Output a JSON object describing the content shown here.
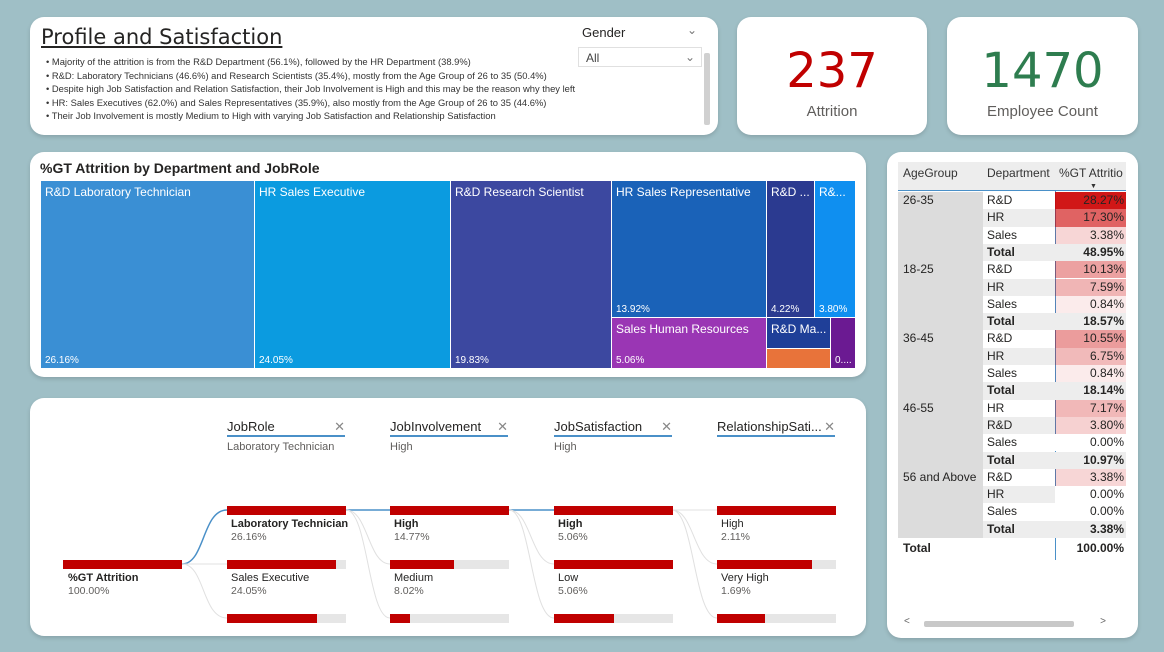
{
  "profile": {
    "title": "Profile and Satisfaction",
    "bullets": [
      "Majority of the attrition is from the R&D Department (56.1%), followed by the HR Department (38.9%)",
      "R&D: Laboratory Technicians (46.6%) and Research Scientists (35.4%), mostly from the Age Group of 26 to 35 (50.4%)",
      "Despite high Job Satisfaction and Relation Satisfaction, their Job Involvement is High and this may be the reason why they left",
      "HR: Sales Executives (62.0%) and Sales Representatives (35.9%), also mostly from the Age Group of 26 to 35 (44.6%)",
      "Their Job Involvement is mostly Medium to High with varying Job Satisfaction and Relationship Satisfaction"
    ],
    "slicer": {
      "title": "Gender",
      "value": "All"
    }
  },
  "kpis": {
    "attrition": {
      "value": "237",
      "label": "Attrition",
      "color": "#c00000"
    },
    "employees": {
      "value": "1470",
      "label": "Employee Count",
      "color": "#2e7d4f"
    }
  },
  "treemap": {
    "title": "%GT Attrition by Department and JobRole",
    "tiles": [
      {
        "label": "R&D Laboratory Technician",
        "value": "26.16%",
        "color": "#3a8fd4"
      },
      {
        "label": "HR Sales Executive",
        "value": "24.05%",
        "color": "#0b9be0"
      },
      {
        "label": "R&D Research Scientist",
        "value": "19.83%",
        "color": "#3c48a0"
      },
      {
        "label": "HR Sales Representative",
        "value": "13.92%",
        "color": "#1a62b8"
      },
      {
        "label": "R&D ...",
        "value": "4.22%",
        "color": "#2b3a90"
      },
      {
        "label": "R&...",
        "value": "3.80%",
        "color": "#0f8ff0"
      },
      {
        "label": "Sales Human Resources",
        "value": "5.06%",
        "color": "#9a36b4"
      },
      {
        "label": "R&D Ma...",
        "value": "",
        "color": "#1f3f98"
      },
      {
        "label": "",
        "value": "",
        "color": "#e8733a"
      },
      {
        "label": "",
        "value": "0....",
        "color": "#6b1a92"
      }
    ]
  },
  "decomp": {
    "columns": [
      {
        "header": "JobRole",
        "selected": "Laboratory Technician"
      },
      {
        "header": "JobInvolvement",
        "selected": "High"
      },
      {
        "header": "JobSatisfaction",
        "selected": "High"
      },
      {
        "header": "RelationshipSati...",
        "selected": ""
      }
    ],
    "root": {
      "label": "%GT Attrition",
      "value": "100.00%",
      "fill": 1.0
    },
    "nodes": [
      [
        {
          "label": "Laboratory Technician",
          "value": "26.16%",
          "fill": 1.0
        },
        {
          "label": "Sales Executive",
          "value": "24.05%",
          "fill": 0.92
        },
        {
          "label": "",
          "value": "",
          "fill": 0.76
        }
      ],
      [
        {
          "label": "High",
          "value": "14.77%",
          "fill": 1.0
        },
        {
          "label": "Medium",
          "value": "8.02%",
          "fill": 0.54
        },
        {
          "label": "",
          "value": "",
          "fill": 0.17
        }
      ],
      [
        {
          "label": "High",
          "value": "5.06%",
          "fill": 1.0
        },
        {
          "label": "Low",
          "value": "5.06%",
          "fill": 1.0
        },
        {
          "label": "",
          "value": "",
          "fill": 0.5
        }
      ],
      [
        {
          "label": "High",
          "value": "2.11%",
          "fill": 1.0
        },
        {
          "label": "Very High",
          "value": "1.69%",
          "fill": 0.8
        },
        {
          "label": "",
          "value": "",
          "fill": 0.4
        }
      ]
    ]
  },
  "matrix": {
    "headers": [
      "AgeGroup",
      "Department",
      "%GT Attritio"
    ],
    "groups": [
      {
        "age": "26-35",
        "rows": [
          [
            "R&D",
            "28.27%",
            0.96
          ],
          [
            "HR",
            "17.30%",
            0.62
          ],
          [
            "Sales",
            "3.38%",
            0.12
          ]
        ],
        "total": "48.95%"
      },
      {
        "age": "18-25",
        "rows": [
          [
            "R&D",
            "10.13%",
            0.36
          ],
          [
            "HR",
            "7.59%",
            0.27
          ],
          [
            "Sales",
            "0.84%",
            0.03
          ]
        ],
        "total": "18.57%"
      },
      {
        "age": "36-45",
        "rows": [
          [
            "R&D",
            "10.55%",
            0.38
          ],
          [
            "HR",
            "6.75%",
            0.24
          ],
          [
            "Sales",
            "0.84%",
            0.03
          ]
        ],
        "total": "18.14%"
      },
      {
        "age": "46-55",
        "rows": [
          [
            "HR",
            "7.17%",
            0.26
          ],
          [
            "R&D",
            "3.80%",
            0.14
          ],
          [
            "Sales",
            "0.00%",
            0.0
          ]
        ],
        "total": "10.97%"
      },
      {
        "age": "56 and Above",
        "rows": [
          [
            "R&D",
            "3.38%",
            0.12
          ],
          [
            "HR",
            "0.00%",
            0.0
          ],
          [
            "Sales",
            "0.00%",
            0.0
          ]
        ],
        "total": "3.38%"
      }
    ],
    "total_label": "Total",
    "grand_total": "100.00%"
  }
}
